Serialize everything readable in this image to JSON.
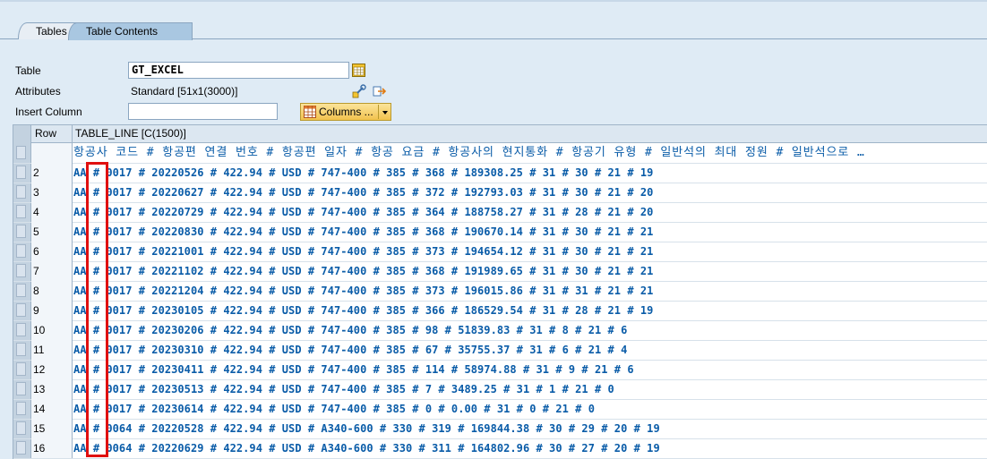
{
  "tabs": [
    {
      "label": "Tables",
      "active": false
    },
    {
      "label": "Table Contents",
      "active": true
    }
  ],
  "form": {
    "table_label": "Table",
    "table_value": "GT_EXCEL",
    "attributes_label": "Attributes",
    "attributes_value": "Standard [51x1(3000)]",
    "insert_column_label": "Insert Column",
    "insert_column_value": "",
    "columns_button": "Columns ..."
  },
  "grid": {
    "col_row": "Row",
    "col_line": "TABLE_LINE [C(1500)]",
    "header_line": "항공사 코드 # 항공편 연결 번호 # 항공편 일자 # 항공 요금 # 항공사의 현지통화 # 항공기 유형 # 일반석의 최대 정원 # 일반석으로 …",
    "rows": [
      {
        "row": "2",
        "line": "AA # 0017 # 20220526 # 422.94 # USD # 747-400 # 385 # 368 # 189308.25 # 31 # 30 # 21 # 19"
      },
      {
        "row": "3",
        "line": "AA # 0017 # 20220627 # 422.94 # USD # 747-400 # 385 # 372 # 192793.03 # 31 # 30 # 21 # 20"
      },
      {
        "row": "4",
        "line": "AA # 0017 # 20220729 # 422.94 # USD # 747-400 # 385 # 364 # 188758.27 # 31 # 28 # 21 # 20"
      },
      {
        "row": "5",
        "line": "AA # 0017 # 20220830 # 422.94 # USD # 747-400 # 385 # 368 # 190670.14 # 31 # 30 # 21 # 21"
      },
      {
        "row": "6",
        "line": "AA # 0017 # 20221001 # 422.94 # USD # 747-400 # 385 # 373 # 194654.12 # 31 # 30 # 21 # 21"
      },
      {
        "row": "7",
        "line": "AA # 0017 # 20221102 # 422.94 # USD # 747-400 # 385 # 368 # 191989.65 # 31 # 30 # 21 # 21"
      },
      {
        "row": "8",
        "line": "AA # 0017 # 20221204 # 422.94 # USD # 747-400 # 385 # 373 # 196015.86 # 31 # 31 # 21 # 21"
      },
      {
        "row": "9",
        "line": "AA # 0017 # 20230105 # 422.94 # USD # 747-400 # 385 # 366 # 186529.54 # 31 # 28 # 21 # 19"
      },
      {
        "row": "10",
        "line": "AA # 0017 # 20230206 # 422.94 # USD # 747-400 # 385 # 98 # 51839.83 # 31 # 8 # 21 # 6"
      },
      {
        "row": "11",
        "line": "AA # 0017 # 20230310 # 422.94 # USD # 747-400 # 385 # 67 # 35755.37 # 31 # 6 # 21 # 4"
      },
      {
        "row": "12",
        "line": "AA # 0017 # 20230411 # 422.94 # USD # 747-400 # 385 # 114 # 58974.88 # 31 # 9 # 21 # 6"
      },
      {
        "row": "13",
        "line": "AA # 0017 # 20230513 # 422.94 # USD # 747-400 # 385 # 7 # 3489.25 # 31 # 1 # 21 # 0"
      },
      {
        "row": "14",
        "line": "AA # 0017 # 20230614 # 422.94 # USD # 747-400 # 385 # 0 # 0.00 # 31 # 0 # 21 # 0"
      },
      {
        "row": "15",
        "line": "AA # 0064 # 20220528 # 422.94 # USD # A340-600 # 330 # 319 # 169844.38 # 30 # 29 # 20 # 19"
      },
      {
        "row": "16",
        "line": "AA # 0064 # 20220629 # 422.94 # USD # A340-600 # 330 # 311 # 164802.96 # 30 # 27 # 20 # 19"
      }
    ]
  },
  "colors": {
    "highlight": "#e01010",
    "data_text": "#0a5ca8"
  }
}
